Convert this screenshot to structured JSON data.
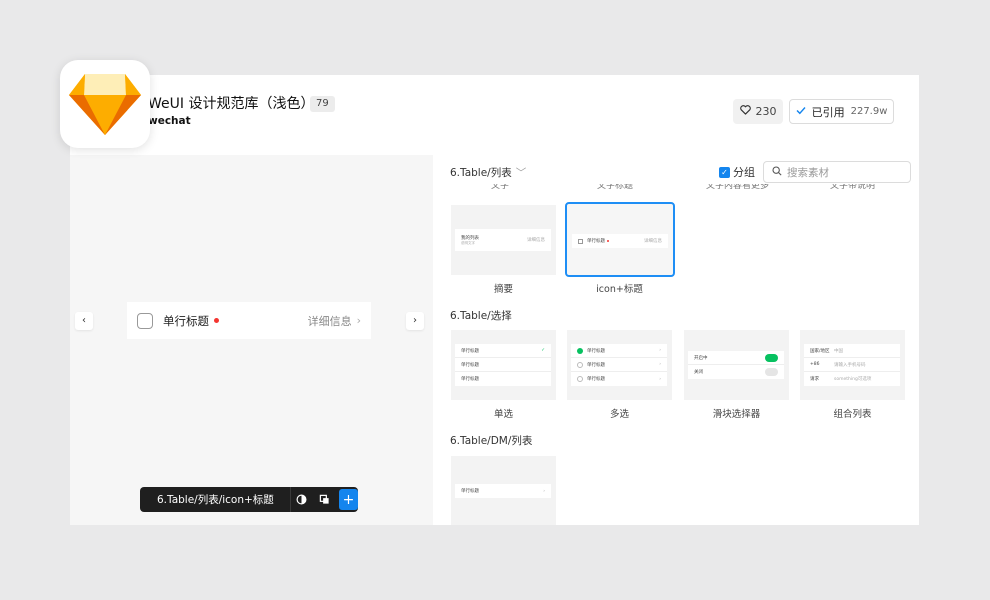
{
  "header": {
    "title": "WeUI 设计规范库（浅色）",
    "count_badge": "79",
    "subtitle": "wechat",
    "likes": "230",
    "cited_label": "已引用",
    "cited_count": "227.9w"
  },
  "preview": {
    "cell_title": "单行标题",
    "cell_detail": "详细信息",
    "toolbar_label": "6.Table/列表/icon+标题"
  },
  "panel": {
    "breadcrumb": "6.Table/列表",
    "group_label": "分组",
    "search_placeholder": "搜索素材",
    "cut_captions": [
      "文字",
      "文字标题",
      "文字内容看更多",
      "文字带说明"
    ],
    "list_section": {
      "items": [
        {
          "caption": "摘要",
          "row_title": "我的列表",
          "row_sub": "说明文字",
          "row_right": "详细信息"
        },
        {
          "caption": "icon+标题",
          "row_title": "单行标题",
          "row_right": "详细信息",
          "selected": true
        }
      ]
    },
    "select_section": {
      "title": "6.Table/选择",
      "items": [
        {
          "caption": "单选",
          "rows": [
            "单行标题",
            "单行标题",
            "单行标题"
          ]
        },
        {
          "caption": "多选",
          "rows": [
            "单行标题",
            "单行标题",
            "单行标题"
          ]
        },
        {
          "caption": "滑块选择器",
          "rows": [
            "开启中",
            "关闭"
          ]
        },
        {
          "caption": "组合列表",
          "rows": [
            "国家/地区",
            "+86",
            "请求"
          ],
          "rows_right": [
            "中国",
            "请输入手机号码",
            "something可选项"
          ]
        }
      ]
    },
    "dm_section": {
      "title": "6.Table/DM/列表",
      "items": [
        {
          "row_title": "单行标题"
        }
      ]
    }
  },
  "colors": {
    "accent": "#1485ee",
    "red_dot": "#f43530",
    "switch_on": "#07c160",
    "toolbar_bg": "#1f1f1f"
  }
}
